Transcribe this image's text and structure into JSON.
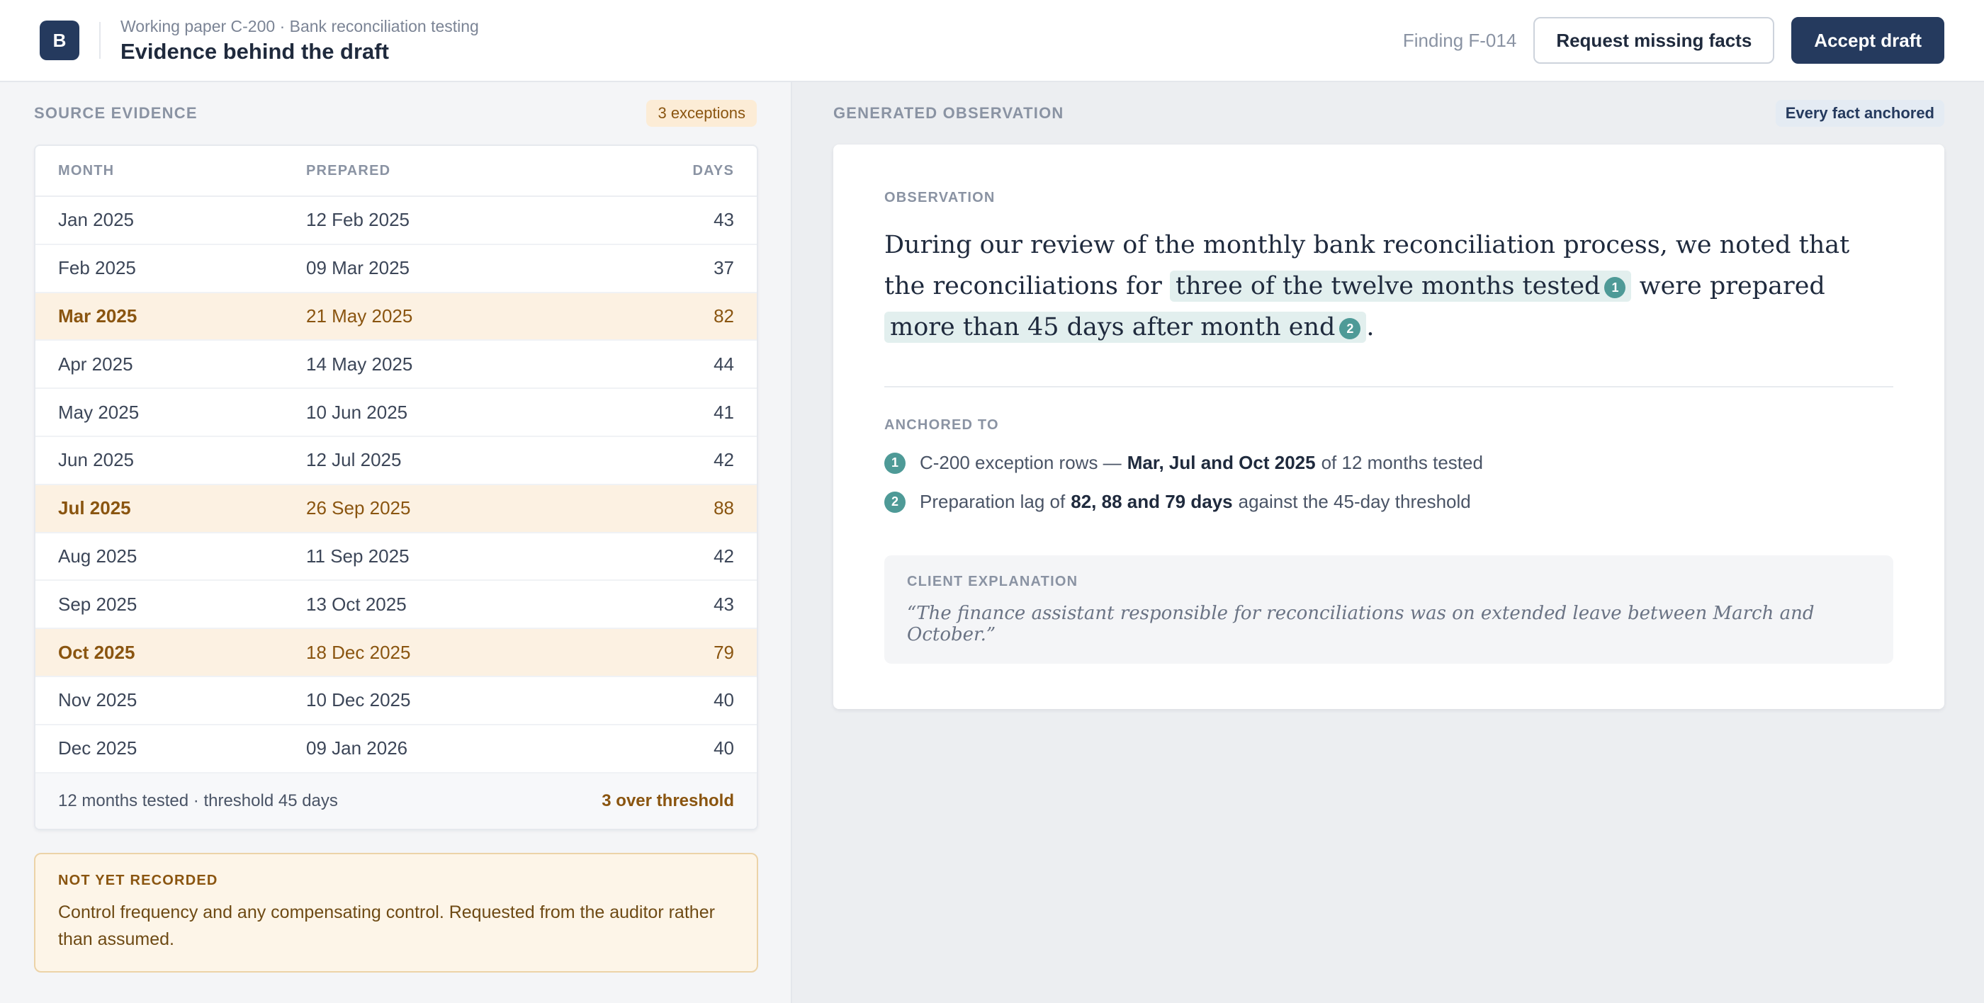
{
  "header": {
    "logo": "B",
    "subtitle": "Working paper C-200 · Bank reconciliation testing",
    "title": "Evidence behind the draft",
    "finding_id": "Finding F-014",
    "request_label": "Request missing facts",
    "accept_label": "Accept draft"
  },
  "source": {
    "label": "SOURCE EVIDENCE",
    "badge": "3 exceptions",
    "columns": [
      "MONTH",
      "PREPARED",
      "DAYS"
    ],
    "rows": [
      {
        "month": "Jan 2025",
        "prepared": "12 Feb 2025",
        "days": "43",
        "exception": false
      },
      {
        "month": "Feb 2025",
        "prepared": "09 Mar 2025",
        "days": "37",
        "exception": false
      },
      {
        "month": "Mar 2025",
        "prepared": "21 May 2025",
        "days": "82",
        "exception": true
      },
      {
        "month": "Apr 2025",
        "prepared": "14 May 2025",
        "days": "44",
        "exception": false
      },
      {
        "month": "May 2025",
        "prepared": "10 Jun 2025",
        "days": "41",
        "exception": false
      },
      {
        "month": "Jun 2025",
        "prepared": "12 Jul 2025",
        "days": "42",
        "exception": false
      },
      {
        "month": "Jul 2025",
        "prepared": "26 Sep 2025",
        "days": "88",
        "exception": true
      },
      {
        "month": "Aug 2025",
        "prepared": "11 Sep 2025",
        "days": "42",
        "exception": false
      },
      {
        "month": "Sep 2025",
        "prepared": "13 Oct 2025",
        "days": "43",
        "exception": false
      },
      {
        "month": "Oct 2025",
        "prepared": "18 Dec 2025",
        "days": "79",
        "exception": true
      },
      {
        "month": "Nov 2025",
        "prepared": "10 Dec 2025",
        "days": "40",
        "exception": false
      },
      {
        "month": "Dec 2025",
        "prepared": "09 Jan 2026",
        "days": "40",
        "exception": false
      }
    ],
    "footer_summary": "12 months tested · threshold 45 days",
    "footer_over": "3 over threshold"
  },
  "note": {
    "label": "NOT YET RECORDED",
    "text": "Control frequency and any compensating control. Requested from the auditor rather than assumed."
  },
  "observation": {
    "section_label": "GENERATED OBSERVATION",
    "badge": "Every fact anchored",
    "card_label": "OBSERVATION",
    "text_1": "During our review of the monthly bank reconciliation process, we noted that the reconciliations for",
    "highlight_1": "three of the twelve months tested",
    "cite_1": "1",
    "text_2": "were prepared",
    "highlight_2": "more than 45 days after month end",
    "cite_2": "2",
    "text_3": ".",
    "anchored_label": "ANCHORED TO",
    "anchors": [
      {
        "num": "1",
        "before": "C-200 exception rows —",
        "bold": "Mar, Jul and Oct 2025",
        "after": "of 12 months tested"
      },
      {
        "num": "2",
        "before": "Preparation lag of",
        "bold": "82, 88 and 79 days",
        "after": "against the 45-day threshold"
      }
    ],
    "client_label": "CLIENT EXPLANATION",
    "client_text": "“The finance assistant responsible for reconciliations was on extended leave between March and October.”"
  },
  "colors": {
    "primary": "#253a5e",
    "exception_bg": "#fcf1e2",
    "exception_text": "#8a5510",
    "cite": "#4e9a97",
    "highlight": "#e2efee"
  }
}
